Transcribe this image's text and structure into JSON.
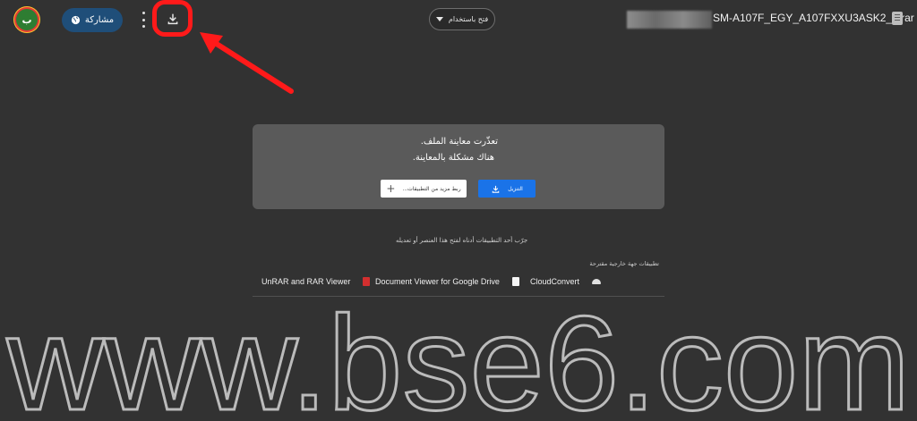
{
  "header": {
    "avatar_letter": "ب",
    "share_label": "مشاركة",
    "open_with_label": "فتح باستخدام",
    "filename": "SM-A107F_EGY_A107FXXU3ASK2_9.rar"
  },
  "preview": {
    "error_title": "تعذّرت معاينة الملف.",
    "error_detail": "هناك مشكلة بالمعاينة.",
    "download_label": "التنزيل",
    "connect_more_label": "ربط مزيد من التطبيقات..."
  },
  "suggestions": {
    "try_text": "جرّب أحد التطبيقات أدناه لفتح هذا العنصر أو تعديله",
    "label": "تطبيقات جهة خارجية مقترحة",
    "apps": [
      {
        "name": "UnRAR and RAR Viewer",
        "icon": "unrar-app-icon"
      },
      {
        "name": "Document Viewer for Google Drive",
        "icon": "document-viewer-icon"
      },
      {
        "name": "CloudConvert",
        "icon": "cloudconvert-icon"
      }
    ]
  },
  "watermark": {
    "text": "www.bse6.com"
  },
  "colors": {
    "background": "#323232",
    "card": "#5a5a5a",
    "primary_button": "#1a73e8",
    "share_button": "#1f4e79",
    "annotation_red": "#ff1a1a"
  }
}
